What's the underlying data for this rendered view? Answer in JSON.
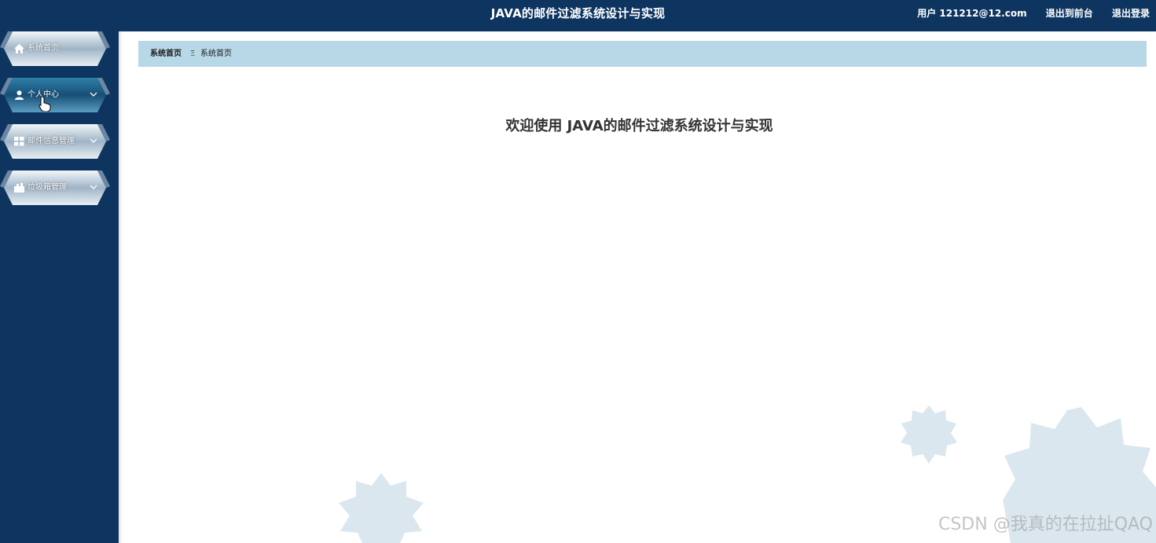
{
  "header": {
    "title": "JAVA的邮件过滤系统设计与实现",
    "user_label": "用户 121212@12.com",
    "back_to_front": "退出到前台",
    "logout": "退出登录"
  },
  "sidebar": {
    "items": [
      {
        "label": "系统首页",
        "icon": "home-icon",
        "has_submenu": false
      },
      {
        "label": "个人中心",
        "icon": "user-icon",
        "has_submenu": true
      },
      {
        "label": "邮件信息管理",
        "icon": "grid-icon",
        "has_submenu": true
      },
      {
        "label": "垃圾箱管理",
        "icon": "trash-box-icon",
        "has_submenu": true
      }
    ]
  },
  "breadcrumb": {
    "root": "系统首页",
    "separator": "Ξ",
    "current": "系统首页"
  },
  "main": {
    "welcome": "欢迎使用 JAVA的邮件过滤系统设计与实现"
  },
  "watermark": "CSDN @我真的在拉扯QAQ",
  "colors": {
    "header_bg": "#0d3560",
    "sidebar_bg": "#0d3560",
    "breadcrumb_bg": "#b7d8e6",
    "decor": "#dbe7ef"
  }
}
